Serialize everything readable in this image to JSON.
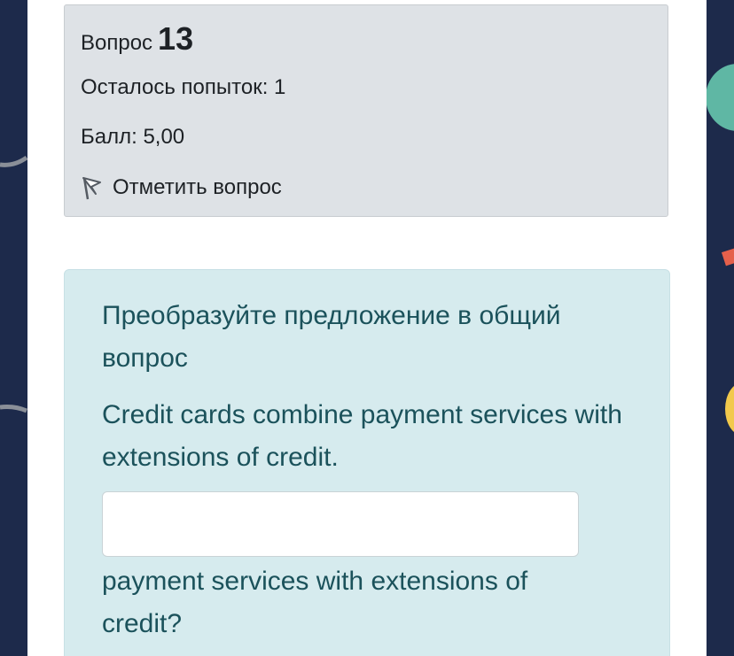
{
  "info": {
    "question_label": "Вопрос",
    "question_number": "13",
    "attempts": "Осталось попыток: 1",
    "grade": "Балл: 5,00",
    "flag_label": "Отметить вопрос"
  },
  "question": {
    "instruction": "Преобразуйте предложение в общий вопрос",
    "sentence": "Credit cards combine payment services with extensions of credit.",
    "answer_value": "",
    "tail": " payment services with extensions of credit?"
  },
  "colors": {
    "background": "#1d2a4b",
    "info_box": "#dee2e6",
    "question_box": "#d6ebee",
    "question_text": "#1b525b"
  }
}
